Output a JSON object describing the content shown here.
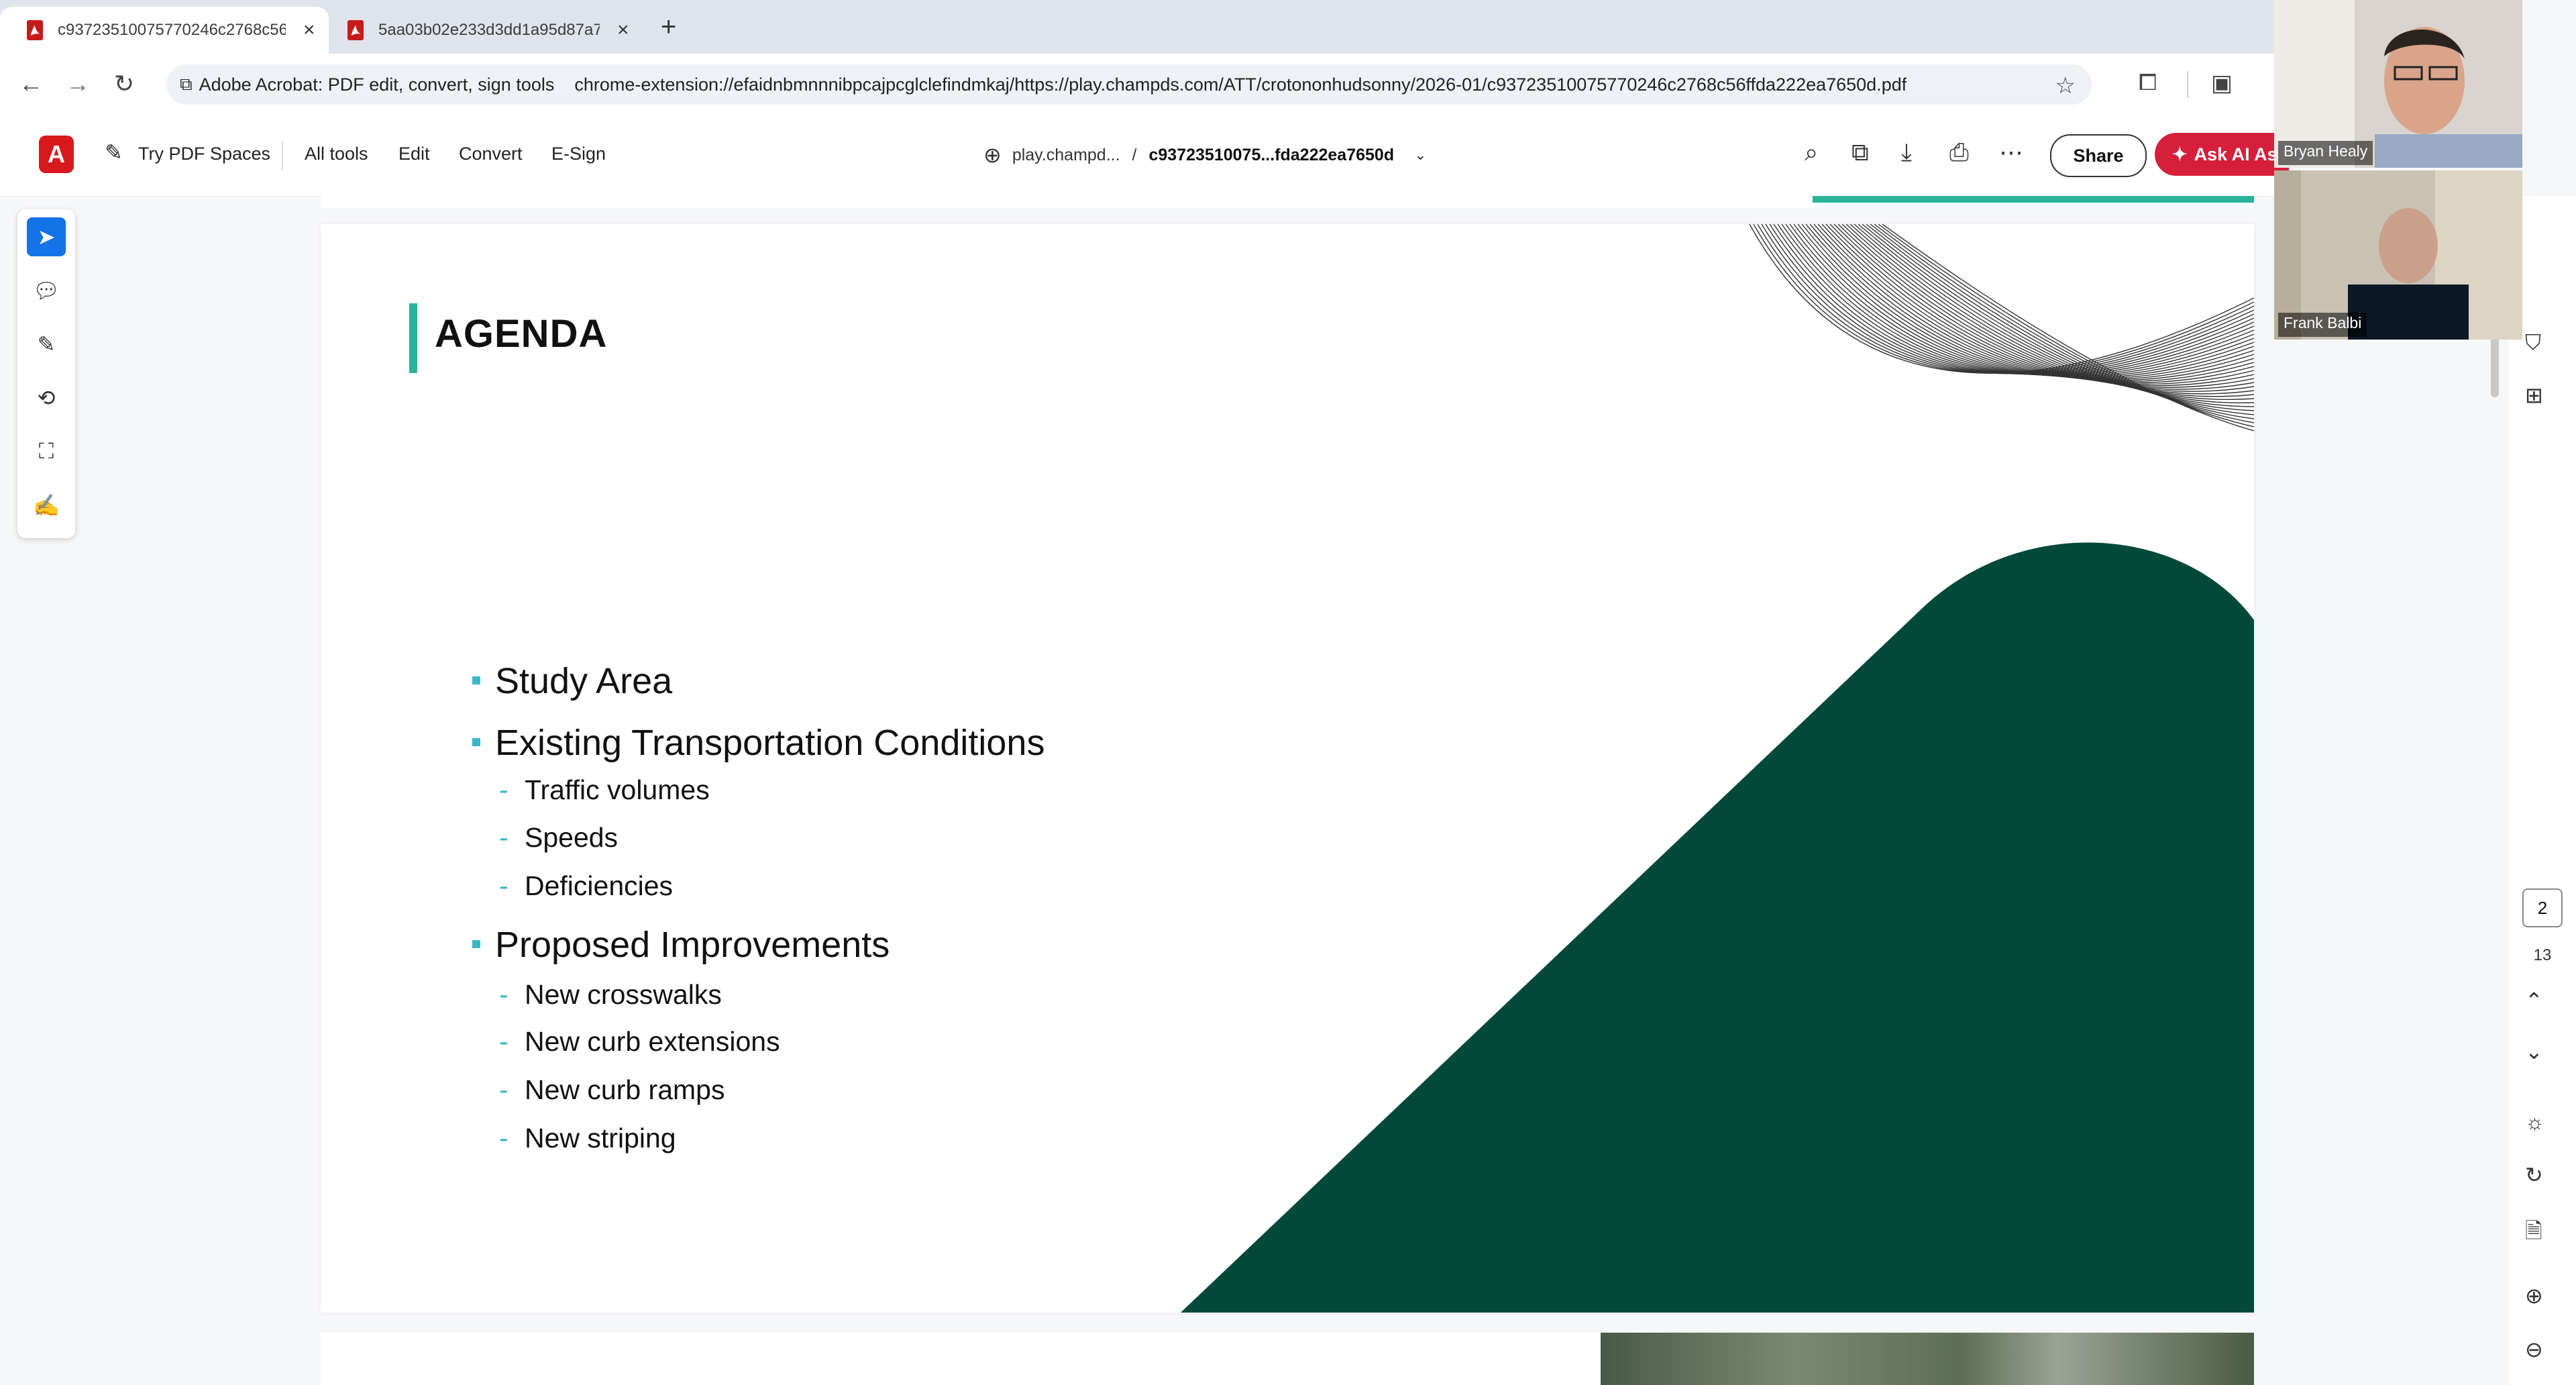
{
  "browser": {
    "tabs": [
      {
        "title": "c93723510075770246c2768c56",
        "close": "×"
      },
      {
        "title": "5aa03b02e233d3dd1a95d87a7",
        "close": "×"
      }
    ],
    "new_tab": "+",
    "extension_chip": "Adobe Acrobat: PDF edit, convert, sign tools",
    "url": "chrome-extension://efaidnbmnnnibpcajpcglclefindmkaj/https://play.champds.com/ATT/crotononhudsonny/2026-01/c93723510075770246c2768c56ffda222ea7650d.pdf"
  },
  "acrobat": {
    "try_spaces": "Try PDF Spaces",
    "menu": [
      "All tools",
      "Edit",
      "Convert",
      "E-Sign"
    ],
    "domain": "play.champd...",
    "crumb_sep": "/",
    "filename": "c93723510075...fda222ea7650d",
    "share": "Share",
    "ask_ai": "Ask AI As"
  },
  "slide": {
    "title": "AGENDA",
    "items": [
      {
        "label": "Study Area",
        "sub": []
      },
      {
        "label": "Existing Transportation Conditions",
        "sub": [
          "Traffic volumes",
          "Speeds",
          "Deficiencies"
        ]
      },
      {
        "label": "Proposed Improvements",
        "sub": [
          "New crosswalks",
          "New curb extensions",
          "New curb ramps",
          "New striping"
        ]
      }
    ],
    "colors": {
      "accent_teal": "#2bb39a",
      "bullet_cyan": "#3cb7c5",
      "hill_green": "#03493a"
    }
  },
  "page_nav": {
    "current": "2",
    "total": "13"
  },
  "participants": [
    {
      "name": "Bryan Healy"
    },
    {
      "name": "Frank Balbi"
    }
  ]
}
